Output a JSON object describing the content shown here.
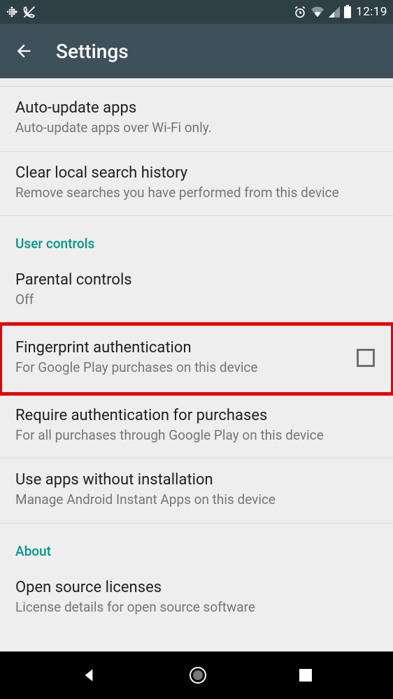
{
  "status": {
    "time": "12:19"
  },
  "header": {
    "title": "Settings"
  },
  "items": {
    "auto_update": {
      "title": "Auto-update apps",
      "subtitle": "Auto-update apps over Wi-Fi only."
    },
    "clear_history": {
      "title": "Clear local search history",
      "subtitle": "Remove searches you have performed from this device"
    },
    "parental": {
      "title": "Parental controls",
      "subtitle": "Off"
    },
    "fingerprint": {
      "title": "Fingerprint authentication",
      "subtitle": "For Google Play purchases on this device",
      "checked": false
    },
    "require_auth": {
      "title": "Require authentication for purchases",
      "subtitle": "For all purchases through Google Play on this device"
    },
    "instant_apps": {
      "title": "Use apps without installation",
      "subtitle": "Manage Android Instant Apps on this device"
    },
    "licenses": {
      "title": "Open source licenses",
      "subtitle": "License details for open source software"
    }
  },
  "sections": {
    "user_controls": "User controls",
    "about": "About"
  }
}
